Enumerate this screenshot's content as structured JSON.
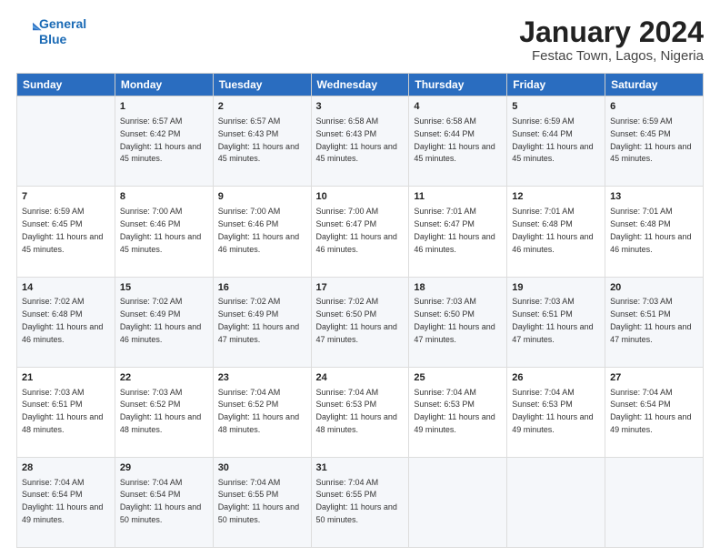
{
  "logo": {
    "line1": "General",
    "line2": "Blue"
  },
  "title": "January 2024",
  "subtitle": "Festac Town, Lagos, Nigeria",
  "days_of_week": [
    "Sunday",
    "Monday",
    "Tuesday",
    "Wednesday",
    "Thursday",
    "Friday",
    "Saturday"
  ],
  "weeks": [
    [
      {
        "num": "",
        "sunrise": "",
        "sunset": "",
        "daylight": ""
      },
      {
        "num": "1",
        "sunrise": "Sunrise: 6:57 AM",
        "sunset": "Sunset: 6:42 PM",
        "daylight": "Daylight: 11 hours and 45 minutes."
      },
      {
        "num": "2",
        "sunrise": "Sunrise: 6:57 AM",
        "sunset": "Sunset: 6:43 PM",
        "daylight": "Daylight: 11 hours and 45 minutes."
      },
      {
        "num": "3",
        "sunrise": "Sunrise: 6:58 AM",
        "sunset": "Sunset: 6:43 PM",
        "daylight": "Daylight: 11 hours and 45 minutes."
      },
      {
        "num": "4",
        "sunrise": "Sunrise: 6:58 AM",
        "sunset": "Sunset: 6:44 PM",
        "daylight": "Daylight: 11 hours and 45 minutes."
      },
      {
        "num": "5",
        "sunrise": "Sunrise: 6:59 AM",
        "sunset": "Sunset: 6:44 PM",
        "daylight": "Daylight: 11 hours and 45 minutes."
      },
      {
        "num": "6",
        "sunrise": "Sunrise: 6:59 AM",
        "sunset": "Sunset: 6:45 PM",
        "daylight": "Daylight: 11 hours and 45 minutes."
      }
    ],
    [
      {
        "num": "7",
        "sunrise": "Sunrise: 6:59 AM",
        "sunset": "Sunset: 6:45 PM",
        "daylight": "Daylight: 11 hours and 45 minutes."
      },
      {
        "num": "8",
        "sunrise": "Sunrise: 7:00 AM",
        "sunset": "Sunset: 6:46 PM",
        "daylight": "Daylight: 11 hours and 45 minutes."
      },
      {
        "num": "9",
        "sunrise": "Sunrise: 7:00 AM",
        "sunset": "Sunset: 6:46 PM",
        "daylight": "Daylight: 11 hours and 46 minutes."
      },
      {
        "num": "10",
        "sunrise": "Sunrise: 7:00 AM",
        "sunset": "Sunset: 6:47 PM",
        "daylight": "Daylight: 11 hours and 46 minutes."
      },
      {
        "num": "11",
        "sunrise": "Sunrise: 7:01 AM",
        "sunset": "Sunset: 6:47 PM",
        "daylight": "Daylight: 11 hours and 46 minutes."
      },
      {
        "num": "12",
        "sunrise": "Sunrise: 7:01 AM",
        "sunset": "Sunset: 6:48 PM",
        "daylight": "Daylight: 11 hours and 46 minutes."
      },
      {
        "num": "13",
        "sunrise": "Sunrise: 7:01 AM",
        "sunset": "Sunset: 6:48 PM",
        "daylight": "Daylight: 11 hours and 46 minutes."
      }
    ],
    [
      {
        "num": "14",
        "sunrise": "Sunrise: 7:02 AM",
        "sunset": "Sunset: 6:48 PM",
        "daylight": "Daylight: 11 hours and 46 minutes."
      },
      {
        "num": "15",
        "sunrise": "Sunrise: 7:02 AM",
        "sunset": "Sunset: 6:49 PM",
        "daylight": "Daylight: 11 hours and 46 minutes."
      },
      {
        "num": "16",
        "sunrise": "Sunrise: 7:02 AM",
        "sunset": "Sunset: 6:49 PM",
        "daylight": "Daylight: 11 hours and 47 minutes."
      },
      {
        "num": "17",
        "sunrise": "Sunrise: 7:02 AM",
        "sunset": "Sunset: 6:50 PM",
        "daylight": "Daylight: 11 hours and 47 minutes."
      },
      {
        "num": "18",
        "sunrise": "Sunrise: 7:03 AM",
        "sunset": "Sunset: 6:50 PM",
        "daylight": "Daylight: 11 hours and 47 minutes."
      },
      {
        "num": "19",
        "sunrise": "Sunrise: 7:03 AM",
        "sunset": "Sunset: 6:51 PM",
        "daylight": "Daylight: 11 hours and 47 minutes."
      },
      {
        "num": "20",
        "sunrise": "Sunrise: 7:03 AM",
        "sunset": "Sunset: 6:51 PM",
        "daylight": "Daylight: 11 hours and 47 minutes."
      }
    ],
    [
      {
        "num": "21",
        "sunrise": "Sunrise: 7:03 AM",
        "sunset": "Sunset: 6:51 PM",
        "daylight": "Daylight: 11 hours and 48 minutes."
      },
      {
        "num": "22",
        "sunrise": "Sunrise: 7:03 AM",
        "sunset": "Sunset: 6:52 PM",
        "daylight": "Daylight: 11 hours and 48 minutes."
      },
      {
        "num": "23",
        "sunrise": "Sunrise: 7:04 AM",
        "sunset": "Sunset: 6:52 PM",
        "daylight": "Daylight: 11 hours and 48 minutes."
      },
      {
        "num": "24",
        "sunrise": "Sunrise: 7:04 AM",
        "sunset": "Sunset: 6:53 PM",
        "daylight": "Daylight: 11 hours and 48 minutes."
      },
      {
        "num": "25",
        "sunrise": "Sunrise: 7:04 AM",
        "sunset": "Sunset: 6:53 PM",
        "daylight": "Daylight: 11 hours and 49 minutes."
      },
      {
        "num": "26",
        "sunrise": "Sunrise: 7:04 AM",
        "sunset": "Sunset: 6:53 PM",
        "daylight": "Daylight: 11 hours and 49 minutes."
      },
      {
        "num": "27",
        "sunrise": "Sunrise: 7:04 AM",
        "sunset": "Sunset: 6:54 PM",
        "daylight": "Daylight: 11 hours and 49 minutes."
      }
    ],
    [
      {
        "num": "28",
        "sunrise": "Sunrise: 7:04 AM",
        "sunset": "Sunset: 6:54 PM",
        "daylight": "Daylight: 11 hours and 49 minutes."
      },
      {
        "num": "29",
        "sunrise": "Sunrise: 7:04 AM",
        "sunset": "Sunset: 6:54 PM",
        "daylight": "Daylight: 11 hours and 50 minutes."
      },
      {
        "num": "30",
        "sunrise": "Sunrise: 7:04 AM",
        "sunset": "Sunset: 6:55 PM",
        "daylight": "Daylight: 11 hours and 50 minutes."
      },
      {
        "num": "31",
        "sunrise": "Sunrise: 7:04 AM",
        "sunset": "Sunset: 6:55 PM",
        "daylight": "Daylight: 11 hours and 50 minutes."
      },
      {
        "num": "",
        "sunrise": "",
        "sunset": "",
        "daylight": ""
      },
      {
        "num": "",
        "sunrise": "",
        "sunset": "",
        "daylight": ""
      },
      {
        "num": "",
        "sunrise": "",
        "sunset": "",
        "daylight": ""
      }
    ]
  ]
}
